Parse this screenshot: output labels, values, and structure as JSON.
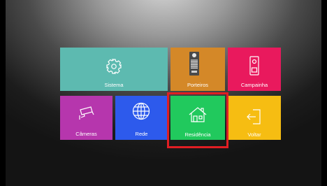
{
  "menu": {
    "sistema_label": "Sistema",
    "porteiros_label": "Porteiros",
    "campainha_label": "Campainha",
    "cameras_label": "Câmeras",
    "rede_label": "Rede",
    "residencia_label": "Residência",
    "voltar_label": "Voltar"
  },
  "selected_item": "residencia",
  "colors": {
    "sistema": "#5dbab0",
    "porteiros": "#d48828",
    "campainha": "#e9195d",
    "cameras": "#b636ad",
    "rede": "#2d5aec",
    "residencia": "#21c95d",
    "voltar": "#f6bd12",
    "selection": "#e01e23"
  },
  "icons": {
    "sistema": "gear-icon",
    "porteiros": "door-station-icon",
    "campainha": "doorbell-icon",
    "cameras": "security-camera-icon",
    "rede": "globe-icon",
    "residencia": "house-icon",
    "voltar": "exit-icon"
  }
}
